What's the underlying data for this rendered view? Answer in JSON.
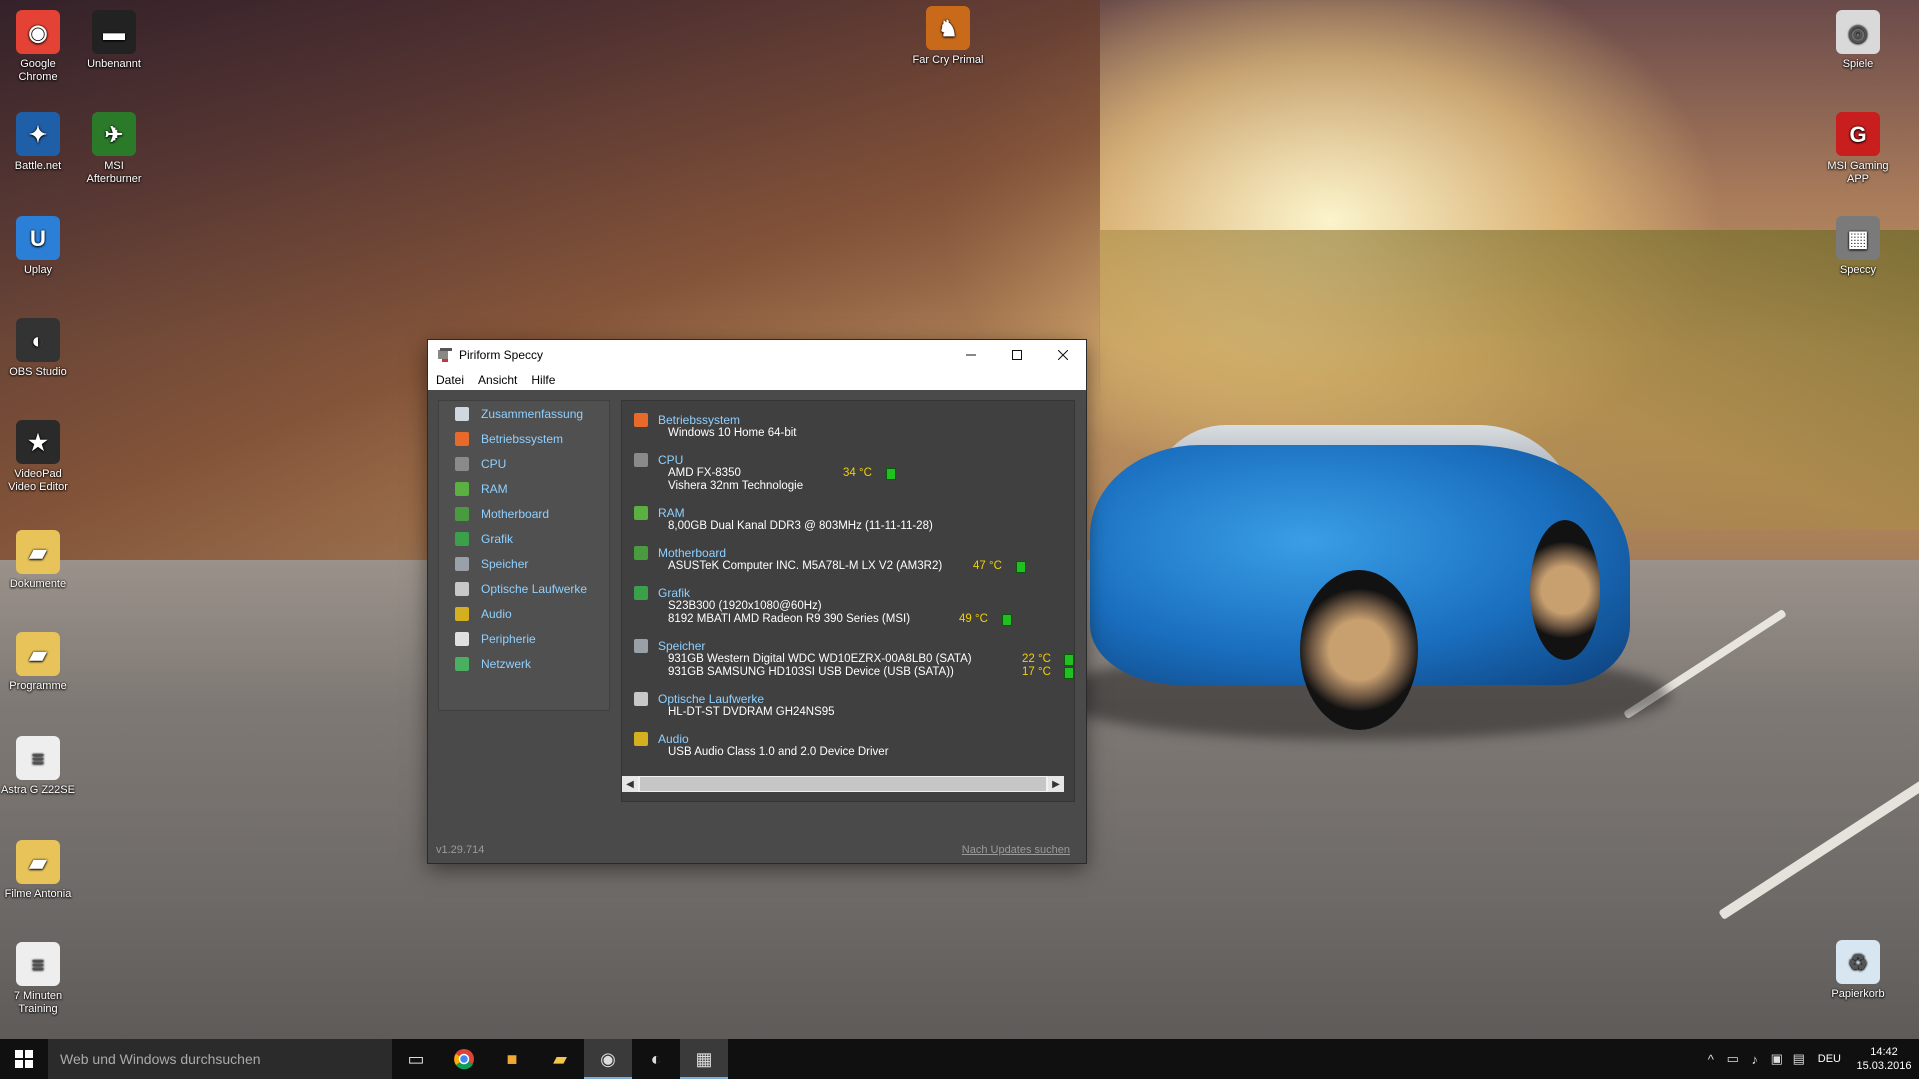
{
  "desktop": {
    "icons_left": [
      {
        "label": "Google Chrome",
        "icon": "chrome-icon"
      },
      {
        "label": "Unbenannt",
        "icon": "monitor-icon"
      },
      {
        "label": "Battle.net",
        "icon": "battlenet-icon"
      },
      {
        "label": "MSI Afterburner",
        "icon": "afterburner-icon"
      },
      {
        "label": "Uplay",
        "icon": "uplay-icon"
      },
      {
        "label": "OBS Studio",
        "icon": "obs-icon"
      },
      {
        "label": "VideoPad Video Editor",
        "icon": "videopad-icon"
      },
      {
        "label": "Dokumente",
        "icon": "folder-icon"
      },
      {
        "label": "Programme",
        "icon": "folder-icon"
      },
      {
        "label": "Astra G Z22SE",
        "icon": "document-icon"
      },
      {
        "label": "Filme Antonia",
        "icon": "folder-icon"
      },
      {
        "label": "7 Minuten Training",
        "icon": "document-icon"
      }
    ],
    "icons_right": [
      {
        "label": "Far Cry Primal",
        "icon": "farcry-icon"
      },
      {
        "label": "Spiele",
        "icon": "spiele-icon"
      },
      {
        "label": "MSI Gaming APP",
        "icon": "msi-icon"
      },
      {
        "label": "Speccy",
        "icon": "speccy-icon"
      },
      {
        "label": "Papierkorb",
        "icon": "recycle-bin-icon"
      }
    ]
  },
  "window": {
    "title": "Piriform Speccy",
    "menu": [
      "Datei",
      "Ansicht",
      "Hilfe"
    ],
    "nav": [
      {
        "label": "Zusammenfassung",
        "color": "#cfd8e0"
      },
      {
        "label": "Betriebssystem",
        "color": "#e86a2a"
      },
      {
        "label": "CPU",
        "color": "#8a8a8a"
      },
      {
        "label": "RAM",
        "color": "#5ab040"
      },
      {
        "label": "Motherboard",
        "color": "#4a9a40"
      },
      {
        "label": "Grafik",
        "color": "#3aa04a"
      },
      {
        "label": "Speicher",
        "color": "#9aa0a8"
      },
      {
        "label": "Optische Laufwerke",
        "color": "#c8c8c8"
      },
      {
        "label": "Audio",
        "color": "#d4b020"
      },
      {
        "label": "Peripherie",
        "color": "#e0e0e0"
      },
      {
        "label": "Netzwerk",
        "color": "#4ab060"
      }
    ],
    "sections": [
      {
        "title": "Betriebssystem",
        "lines": [
          "Windows 10 Home 64-bit"
        ]
      },
      {
        "title": "CPU",
        "lines": [
          "AMD FX-8350",
          "Vishera 32nm Technologie"
        ],
        "temp": "34 °C"
      },
      {
        "title": "RAM",
        "lines": [
          "8,00GB Dual Kanal DDR3 @ 803MHz (11-11-11-28)"
        ]
      },
      {
        "title": "Motherboard",
        "lines": [
          "ASUSTeK Computer INC. M5A78L-M LX V2 (AM3R2)"
        ],
        "temp": "47 °C"
      },
      {
        "title": "Grafik",
        "lines": [
          "S23B300 (1920x1080@60Hz)",
          "8192 MBATI AMD Radeon R9 390 Series (MSI)"
        ],
        "temp": "49 °C"
      },
      {
        "title": "Speicher",
        "lines": [
          "931GB Western Digital WDC WD10EZRX-00A8LB0 (SATA)",
          "931GB SAMSUNG HD103SI USB Device (USB (SATA))"
        ],
        "temps": [
          "22 °C",
          "17 °C"
        ]
      },
      {
        "title": "Optische Laufwerke",
        "lines": [
          "HL-DT-ST DVDRAM GH24NS95"
        ]
      },
      {
        "title": "Audio",
        "lines": [
          "USB Audio Class 1.0 and 2.0 Device Driver"
        ]
      }
    ],
    "version": "v1.29.714",
    "update_link": "Nach Updates suchen"
  },
  "taskbar": {
    "search_placeholder": "Web und Windows durchsuchen",
    "language": "DEU",
    "time": "14:42",
    "date": "15.03.2016"
  }
}
